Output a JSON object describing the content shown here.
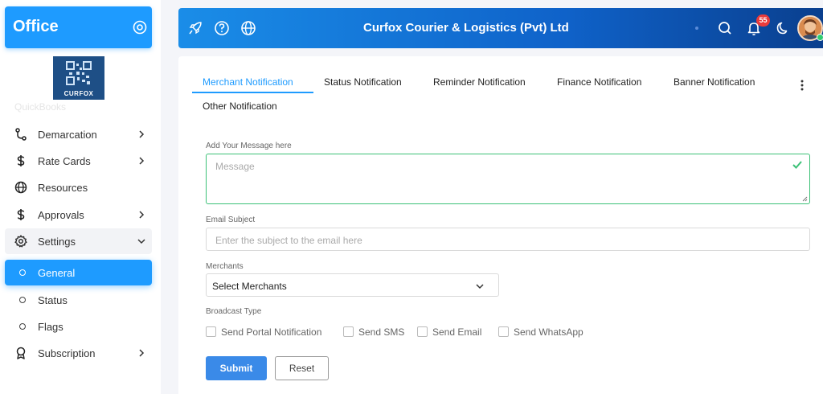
{
  "sidebar": {
    "brand_title": "Office",
    "logo_text": "CURFOX",
    "faded_item": "QuickBooks",
    "items": [
      {
        "label": "Demarcation",
        "icon": "route-icon",
        "has_chevron": true
      },
      {
        "label": "Rate Cards",
        "icon": "dollar-icon",
        "has_chevron": true
      },
      {
        "label": "Resources",
        "icon": "globe-icon",
        "has_chevron": false
      },
      {
        "label": "Approvals",
        "icon": "dollar-icon",
        "has_chevron": true
      },
      {
        "label": "Settings",
        "icon": "gear-icon",
        "has_chevron": true,
        "expanded": true
      },
      {
        "label": "General",
        "icon": "circle-icon",
        "active": true
      },
      {
        "label": "Status",
        "icon": "circle-icon"
      },
      {
        "label": "Flags",
        "icon": "circle-icon"
      },
      {
        "label": "Subscription",
        "icon": "award-icon",
        "has_chevron": true
      }
    ]
  },
  "header": {
    "title": "Curfox Courier & Logistics (Pvt) Ltd",
    "notification_count": "55",
    "icons": [
      "rocket-icon",
      "help-icon",
      "globe-icon",
      "search-icon",
      "bell-icon",
      "moon-icon",
      "avatar"
    ]
  },
  "tabs": [
    {
      "label": "Merchant Notification",
      "active": true
    },
    {
      "label": "Status Notification"
    },
    {
      "label": "Reminder Notification"
    },
    {
      "label": "Finance Notification"
    },
    {
      "label": "Banner Notification"
    },
    {
      "label": "Other Notification"
    }
  ],
  "form": {
    "message_label": "Add Your Message here",
    "message_placeholder": "Message",
    "email_subject_label": "Email Subject",
    "email_subject_placeholder": "Enter the subject to the email here",
    "merchants_label": "Merchants",
    "merchants_selected": "Select Merchants",
    "broadcast_label": "Broadcast Type",
    "broadcast_options": [
      {
        "label": "Send Portal Notification",
        "checked": false
      },
      {
        "label": "Send SMS",
        "checked": false
      },
      {
        "label": "Send Email",
        "checked": false
      },
      {
        "label": "Send WhatsApp",
        "checked": false
      }
    ],
    "submit_label": "Submit",
    "reset_label": "Reset"
  },
  "colors": {
    "primary": "#1e9bff",
    "header_start": "#1a8de8",
    "header_end": "#0a3f8e",
    "success": "#3cc177",
    "badge": "#ea3b3b"
  }
}
